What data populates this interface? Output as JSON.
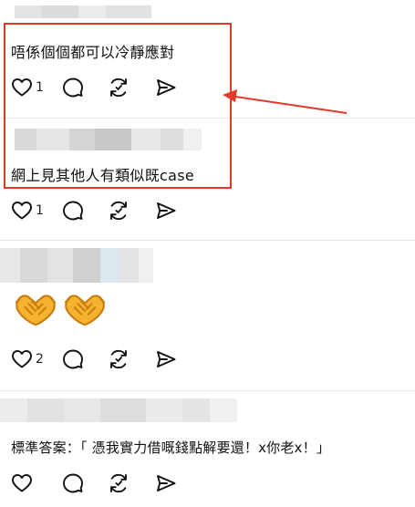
{
  "posts": [
    {
      "text": "唔係個個都可以冷靜應對",
      "likes": "1"
    },
    {
      "text": "網上見其他人有類似既case",
      "likes": "1"
    },
    {
      "text": "",
      "likes": "2",
      "emojis": [
        "handshake",
        "handshake"
      ]
    },
    {
      "text": "標準答案：「 憑我實力借嘅錢點解要還！x你老x！」",
      "likes": ""
    }
  ],
  "icons": {
    "like": "heart-icon",
    "reply": "comment-bubble-icon",
    "repost": "repost-arrows-icon",
    "share": "send-icon",
    "emoji": "handshake-emoji-icon"
  },
  "colors": {
    "annotation": "#e23b2b",
    "divider": "#e6e6e6",
    "icon": "#111111",
    "emoji_fill": "#f4b22e",
    "emoji_outline": "#c77d10"
  }
}
